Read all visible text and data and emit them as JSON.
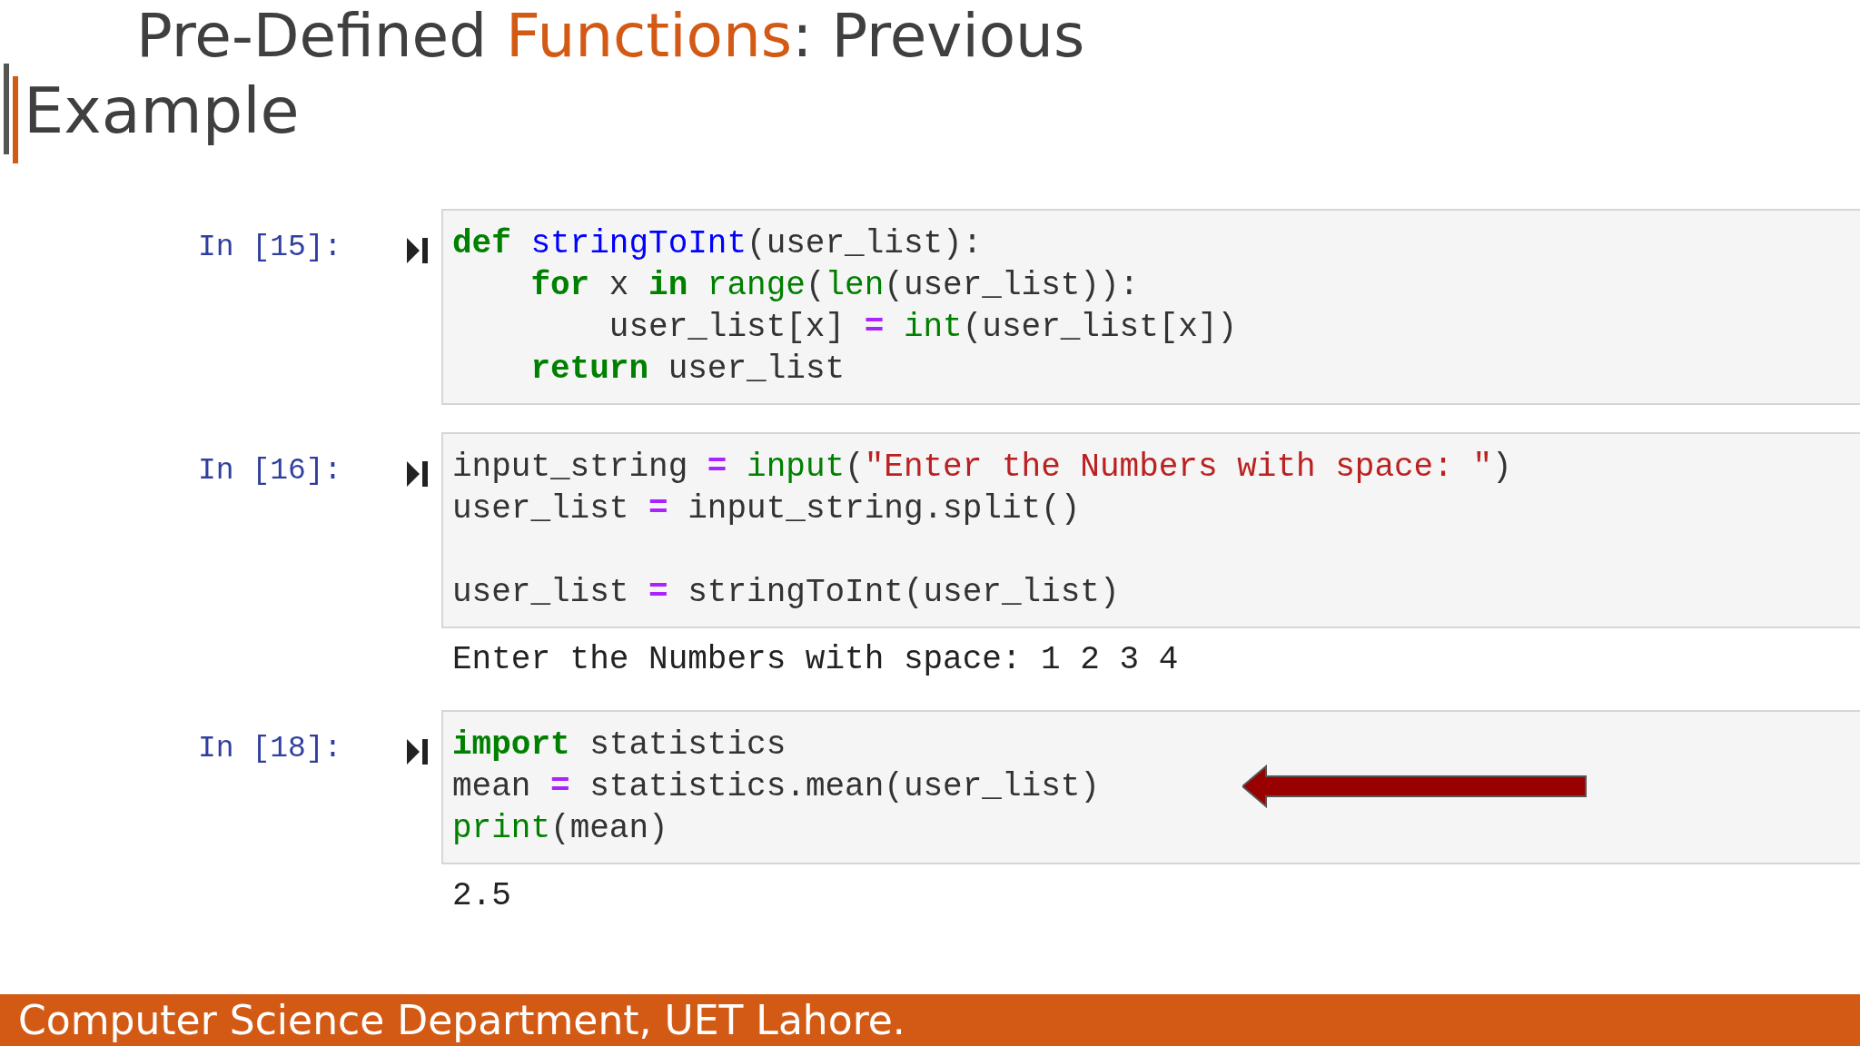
{
  "title": {
    "line_1": [
      {
        "kind": "plain",
        "text": "Pre-Defined "
      },
      {
        "kind": "accent",
        "text": "Functions"
      },
      {
        "kind": "plain",
        "text": ": Previous"
      }
    ],
    "line_2": "Example"
  },
  "cells": [
    {
      "prompt": "In [15]:",
      "lines": [
        {
          "kind": "code",
          "tokens": [
            {
              "kind": "kw",
              "text": "def"
            },
            {
              "kind": "fn",
              "text": " stringToInt"
            },
            {
              "kind": "plain",
              "text": "(user_list):"
            }
          ]
        },
        {
          "kind": "code",
          "tokens": [
            {
              "kind": "kw",
              "text": "    for"
            },
            {
              "kind": "plain",
              "text": " x "
            },
            {
              "kind": "kw",
              "text": "in"
            },
            {
              "kind": "builtin",
              "text": " range"
            },
            {
              "kind": "plain",
              "text": "("
            },
            {
              "kind": "builtin",
              "text": "len"
            },
            {
              "kind": "plain",
              "text": "(user_list)):"
            }
          ]
        },
        {
          "kind": "code",
          "tokens": [
            {
              "kind": "plain",
              "text": "        user_list[x] "
            },
            {
              "kind": "op",
              "text": "="
            },
            {
              "kind": "builtin",
              "text": " int"
            },
            {
              "kind": "plain",
              "text": "(user_list[x])"
            }
          ]
        },
        {
          "kind": "code",
          "tokens": [
            {
              "kind": "kw",
              "text": "    return"
            },
            {
              "kind": "plain",
              "text": " user_list"
            }
          ]
        }
      ]
    },
    {
      "prompt": "In [16]:",
      "lines": [
        {
          "kind": "code",
          "tokens": [
            {
              "kind": "plain",
              "text": "input_string "
            },
            {
              "kind": "op",
              "text": "="
            },
            {
              "kind": "builtin",
              "text": " input"
            },
            {
              "kind": "plain",
              "text": "("
            },
            {
              "kind": "str",
              "text": "\"Enter the Numbers with space: \""
            },
            {
              "kind": "plain",
              "text": ")"
            }
          ]
        },
        {
          "kind": "code",
          "tokens": [
            {
              "kind": "plain",
              "text": "user_list "
            },
            {
              "kind": "op",
              "text": "="
            },
            {
              "kind": "plain",
              "text": " input_string.split()"
            }
          ]
        },
        {
          "kind": "blank"
        },
        {
          "kind": "code",
          "tokens": [
            {
              "kind": "plain",
              "text": "user_list "
            },
            {
              "kind": "op",
              "text": "="
            },
            {
              "kind": "plain",
              "text": " stringToInt(user_list)"
            }
          ]
        }
      ],
      "output": "Enter the Numbers with space: 1 2 3 4"
    },
    {
      "prompt": "In [18]:",
      "arrow": true,
      "lines": [
        {
          "kind": "code",
          "tokens": [
            {
              "kind": "kw",
              "text": "import"
            },
            {
              "kind": "plain",
              "text": " statistics"
            }
          ]
        },
        {
          "kind": "code",
          "tokens": [
            {
              "kind": "plain",
              "text": "mean "
            },
            {
              "kind": "op",
              "text": "="
            },
            {
              "kind": "plain",
              "text": " statistics.mean(user_list)"
            }
          ]
        },
        {
          "kind": "code",
          "tokens": [
            {
              "kind": "builtin",
              "text": "print"
            },
            {
              "kind": "plain",
              "text": "(mean)"
            }
          ]
        }
      ],
      "output": "2.5"
    }
  ],
  "footer": "Computer Science Department, UET Lahore."
}
